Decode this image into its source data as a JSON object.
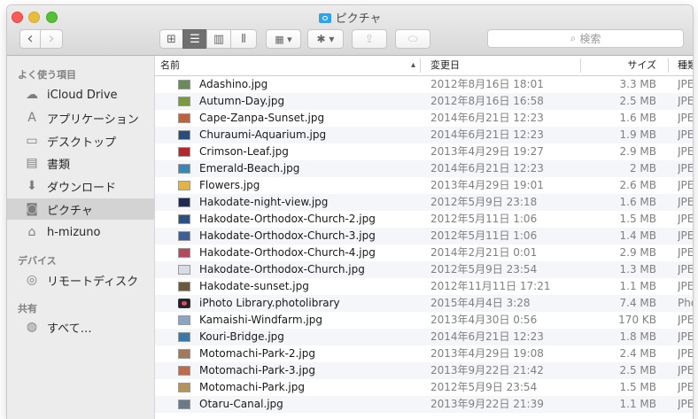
{
  "window": {
    "title": "ピクチャ"
  },
  "toolbar": {
    "back_glyph": "‹",
    "forward_glyph": "›",
    "view_icons_glyph": "⊞",
    "view_list_glyph": "☰",
    "view_columns_glyph": "▥",
    "view_coverflow_glyph": "⫴",
    "arrange_glyph": "▦ ▾",
    "action_glyph": "✱ ▾",
    "share_glyph": "⇪",
    "tag_glyph": "⬭",
    "search_placeholder": "検索",
    "search_glyph": "⌕"
  },
  "sidebar": {
    "favorites_header": "よく使う項目",
    "favorites": [
      {
        "label": "iCloud Drive",
        "icon": "cloud-icon",
        "glyph": "☁"
      },
      {
        "label": "アプリケーション",
        "icon": "applications-icon",
        "glyph": "A"
      },
      {
        "label": "デスクトップ",
        "icon": "desktop-icon",
        "glyph": "▭"
      },
      {
        "label": "書類",
        "icon": "documents-icon",
        "glyph": "▤"
      },
      {
        "label": "ダウンロード",
        "icon": "downloads-icon",
        "glyph": "⬇"
      },
      {
        "label": "ピクチャ",
        "icon": "camera-icon",
        "glyph": "◙",
        "selected": true
      },
      {
        "label": "h-mizuno",
        "icon": "home-icon",
        "glyph": "⌂"
      }
    ],
    "devices_header": "デバイス",
    "devices": [
      {
        "label": "リモートディスク",
        "icon": "disc-icon",
        "glyph": "◎"
      }
    ],
    "shared_header": "共有",
    "shared": [
      {
        "label": "すべて…",
        "icon": "network-icon",
        "glyph": "◍"
      }
    ]
  },
  "columns": {
    "name": "名前",
    "sort_glyph": "▴",
    "date": "変更日",
    "size": "サイズ",
    "kind": "種類"
  },
  "files": [
    {
      "name": "Adashino.jpg",
      "date": "2012年8月16日 18:01",
      "size": "3.3 MB",
      "kind": "JPEG",
      "thumb": "#6b8a5a"
    },
    {
      "name": "Autumn-Day.jpg",
      "date": "2012年8月16日 16:58",
      "size": "2.5 MB",
      "kind": "JPEG",
      "thumb": "#7a9b3c"
    },
    {
      "name": "Cape-Zanpa-Sunset.jpg",
      "date": "2014年6月21日 12:23",
      "size": "1.6 MB",
      "kind": "JPEG",
      "thumb": "#c0623a"
    },
    {
      "name": "Churaumi-Aquarium.jpg",
      "date": "2014年6月21日 12:23",
      "size": "1.9 MB",
      "kind": "JPEG",
      "thumb": "#2a4c7a"
    },
    {
      "name": "Crimson-Leaf.jpg",
      "date": "2013年4月29日 19:27",
      "size": "2.9 MB",
      "kind": "JPEG",
      "thumb": "#b3282c"
    },
    {
      "name": "Emerald-Beach.jpg",
      "date": "2014年6月21日 12:23",
      "size": "2 MB",
      "kind": "JPEG",
      "thumb": "#3a86b8"
    },
    {
      "name": "Flowers.jpg",
      "date": "2013年4月29日 19:01",
      "size": "2.6 MB",
      "kind": "JPEG",
      "thumb": "#e1b444"
    },
    {
      "name": "Hakodate-night-view.jpg",
      "date": "2012年5月9日 23:18",
      "size": "1.6 MB",
      "kind": "JPEG",
      "thumb": "#1d2b55"
    },
    {
      "name": "Hakodate-Orthodox-Church-2.jpg",
      "date": "2012年5月11日 1:06",
      "size": "1.5 MB",
      "kind": "JPEG",
      "thumb": "#2c4f86"
    },
    {
      "name": "Hakodate-Orthodox-Church-3.jpg",
      "date": "2012年5月11日 1:06",
      "size": "1.4 MB",
      "kind": "JPEG",
      "thumb": "#3c5f96"
    },
    {
      "name": "Hakodate-Orthodox-Church-4.jpg",
      "date": "2014年2月21日 0:01",
      "size": "2.9 MB",
      "kind": "JPEG",
      "thumb": "#b44a5a"
    },
    {
      "name": "Hakodate-Orthodox-Church.jpg",
      "date": "2012年5月9日 23:54",
      "size": "1.3 MB",
      "kind": "JPEG",
      "thumb": "#d8dce4"
    },
    {
      "name": "Hakodate-sunset.jpg",
      "date": "2012年11月11日 17:21",
      "size": "1.1 MB",
      "kind": "JPEG",
      "thumb": "#6a5a3a"
    },
    {
      "name": "iPhoto Library.photolibrary",
      "date": "2015年4月4日 3:28",
      "size": "7.4 MB",
      "kind": "Pho",
      "thumb": "app"
    },
    {
      "name": "Kamaishi-Windfarm.jpg",
      "date": "2013年4月30日 0:56",
      "size": "170 KB",
      "kind": "JPEG",
      "thumb": "#8aa6c4"
    },
    {
      "name": "Kouri-Bridge.jpg",
      "date": "2014年6月21日 12:23",
      "size": "1.8 MB",
      "kind": "JPEG",
      "thumb": "#3b78a8"
    },
    {
      "name": "Motomachi-Park-2.jpg",
      "date": "2013年4月29日 19:08",
      "size": "2.4 MB",
      "kind": "JPEG",
      "thumb": "#a07a5a"
    },
    {
      "name": "Motomachi-Park-3.jpg",
      "date": "2013年9月22日 21:42",
      "size": "2.5 MB",
      "kind": "JPEG",
      "thumb": "#c06a4a"
    },
    {
      "name": "Motomachi-Park.jpg",
      "date": "2012年5月9日 23:54",
      "size": "1.5 MB",
      "kind": "JPEG",
      "thumb": "#b4945a"
    },
    {
      "name": "Otaru-Canal.jpg",
      "date": "2013年9月22日 21:39",
      "size": "1.1 MB",
      "kind": "JPEG",
      "thumb": "#6a7a8a"
    }
  ]
}
